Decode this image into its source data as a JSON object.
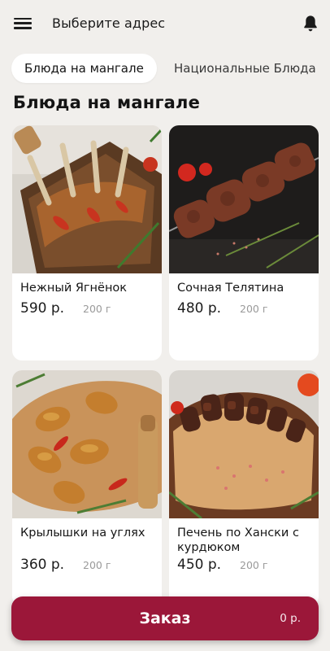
{
  "header": {
    "title": "Выберите адрес",
    "menu_icon": "hamburger-menu-icon",
    "notification_icon": "bell-icon"
  },
  "tabs": [
    {
      "label": "Блюда на мангале",
      "active": true
    },
    {
      "label": "Национальные Блюда",
      "active": false
    }
  ],
  "section": {
    "title": "Блюда на мангале"
  },
  "products": [
    {
      "name": "Нежный Ягнёнок",
      "price": "590 р.",
      "weight": "200 г"
    },
    {
      "name": "Сочная Телятина",
      "price": "480 р.",
      "weight": "200 г"
    },
    {
      "name": "Крылышки на углях",
      "price": "360 р.",
      "weight": "200 г"
    },
    {
      "name": "Печень по Хански с курдюком",
      "price": "450 р.",
      "weight": "200 г"
    }
  ],
  "order": {
    "label": "Заказ",
    "total": "0 р."
  },
  "colors": {
    "background": "#f1efec",
    "card": "#ffffff",
    "accent": "#9b1739"
  }
}
